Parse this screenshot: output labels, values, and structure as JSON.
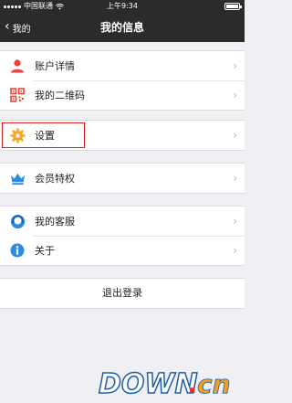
{
  "status_bar": {
    "carrier": "中国联通",
    "time": "上午9:34"
  },
  "nav": {
    "back_label": "我的",
    "title": "我的信息"
  },
  "groups": [
    {
      "items": [
        {
          "label": "账户详情",
          "icon": "person-icon"
        },
        {
          "label": "我的二维码",
          "icon": "qrcode-icon"
        }
      ]
    },
    {
      "items": [
        {
          "label": "设置",
          "icon": "gear-icon",
          "highlighted": true
        }
      ]
    },
    {
      "items": [
        {
          "label": "会员特权",
          "icon": "crown-icon"
        }
      ]
    },
    {
      "items": [
        {
          "label": "我的客服",
          "icon": "customer-service-icon"
        },
        {
          "label": "关于",
          "icon": "info-icon"
        }
      ]
    }
  ],
  "logout_label": "退出登录",
  "watermark": {
    "text_main": "DOWN",
    "text_dot": ".",
    "text_cn": "cn"
  },
  "colors": {
    "nav_background": "#2b2b2b",
    "page_background": "#efeff4",
    "highlight_border": "#e02020",
    "person_icon": "#e8453c",
    "qrcode_icon": "#e8453c",
    "gear_icon": "#f5a623",
    "crown_icon": "#2a8be0",
    "service_icon": "#2a8be0",
    "info_icon": "#2a8be0"
  }
}
